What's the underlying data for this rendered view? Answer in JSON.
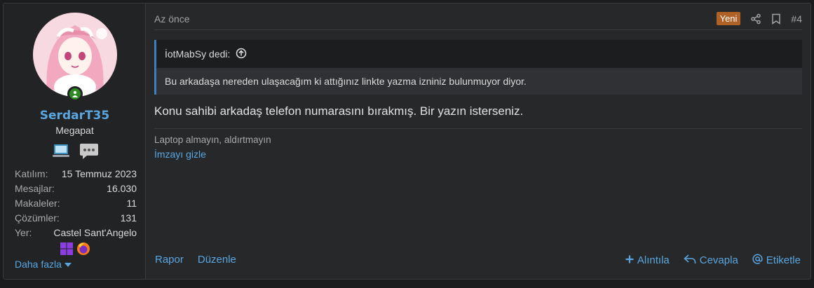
{
  "user": {
    "username": "SerdarT35",
    "title": "Megapat",
    "stats": [
      {
        "label": "Katılım:",
        "value": "15 Temmuz 2023"
      },
      {
        "label": "Mesajlar:",
        "value": "16.030"
      },
      {
        "label": "Makaleler:",
        "value": "11"
      },
      {
        "label": "Çözümler:",
        "value": "131"
      },
      {
        "label": "Yer:",
        "value": "Castel Sant'Angelo"
      }
    ],
    "more_label": "Daha fazla",
    "status_color": "#2e8b24",
    "icons": [
      "laptop-banner-icon",
      "chat-banner-icon",
      "windows-icon",
      "firefox-icon"
    ]
  },
  "post": {
    "date": "Az önce",
    "new_badge": "Yeni",
    "number": "#4",
    "quote": {
      "author": "İotMabSy dedi:",
      "text": "Bu arkadaşa nereden ulaşacağım ki attığınız linkte yazma izniniz bulunmuyor diyor."
    },
    "message": "Konu sahibi arkadaş telefon numarasını bırakmış. Bir yazın isterseniz.",
    "signature": "Laptop almayın, aldırtmayın",
    "hide_signature": "İmzayı gizle"
  },
  "actions": {
    "report": "Rapor",
    "edit": "Düzenle",
    "quote": "Alıntıla",
    "reply": "Cevapla",
    "tag": "Etiketle"
  },
  "colors": {
    "accent": "#5aa6e0",
    "badge": "#b06125",
    "quote_border": "#3e7fc1"
  }
}
